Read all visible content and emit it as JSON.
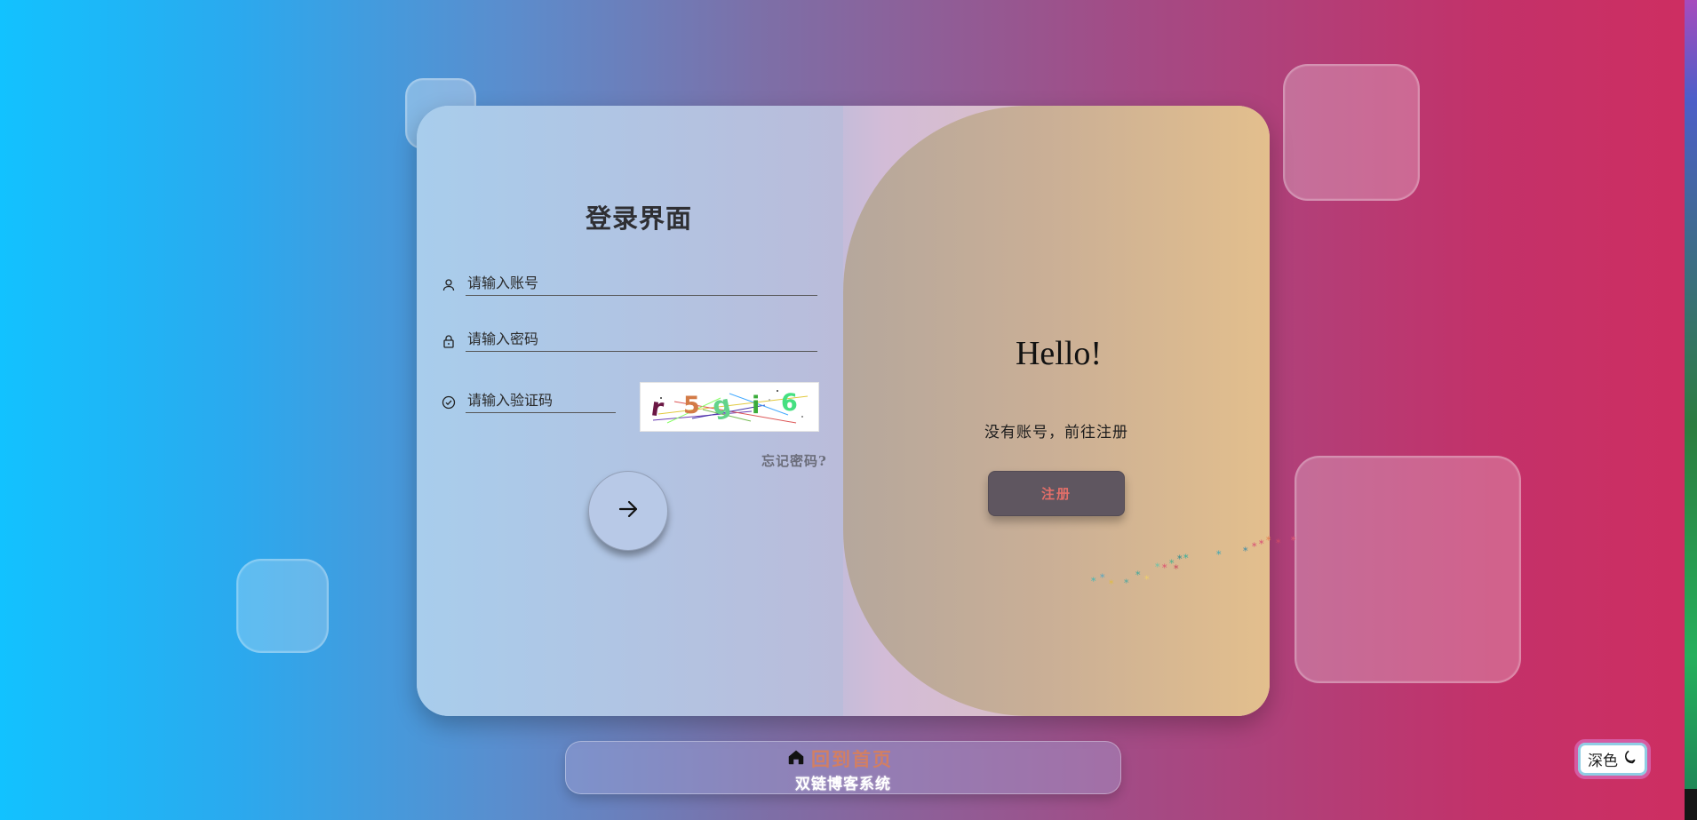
{
  "login": {
    "title": "登录界面",
    "username_placeholder": "请输入账号",
    "password_placeholder": "请输入密码",
    "captcha_placeholder": "请输入验证码",
    "captcha_text": "r5gi6",
    "forgot_password": "忘记密码?"
  },
  "register_panel": {
    "greeting": "Hello!",
    "prompt": "没有账号，前往注册",
    "button_label": "注册"
  },
  "bottom_bar": {
    "home_link": "回到首页",
    "site_name": "双链博客系统"
  },
  "theme_toggle": {
    "label": "深色"
  },
  "icons": {
    "user": "user-icon",
    "lock": "lock-icon",
    "check": "check-circle-icon",
    "submit": "arrow-right-icon",
    "home": "home-icon",
    "theme": "moon-icon"
  },
  "colors": {
    "background_left": "#12c2ff",
    "background_right": "#ce2e61",
    "register_button": "#5f5660",
    "register_text": "#e36f69",
    "home_link": "#d27f63"
  }
}
